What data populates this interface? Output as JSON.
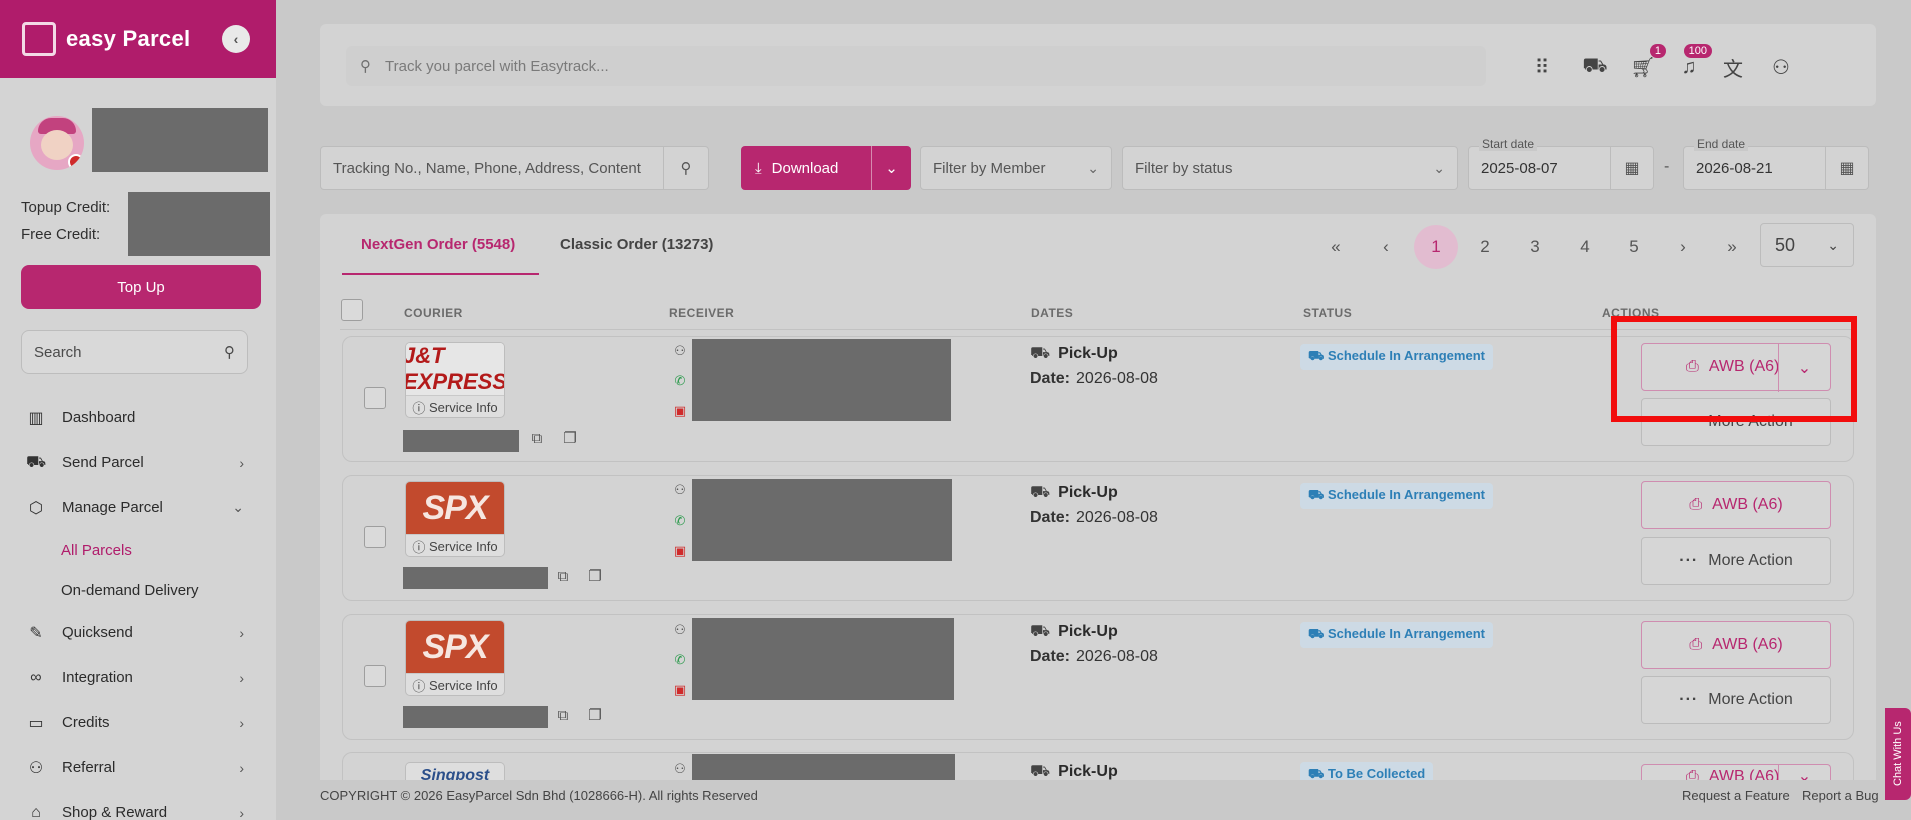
{
  "brand": {
    "name": "easy Parcel"
  },
  "sidebar": {
    "topup_credit_label": "Topup Credit:",
    "free_credit_label": "Free Credit:",
    "topup_button": "Top Up",
    "search_placeholder": "Search",
    "items": [
      {
        "label": "Dashboard",
        "icon": "chart-bar-icon"
      },
      {
        "label": "Send Parcel",
        "icon": "truck-icon"
      },
      {
        "label": "Manage Parcel",
        "icon": "box-icon"
      },
      {
        "label": "Quicksend",
        "icon": "pen-icon"
      },
      {
        "label": "Integration",
        "icon": "link-icon"
      },
      {
        "label": "Credits",
        "icon": "wallet-icon"
      },
      {
        "label": "Referral",
        "icon": "user-plus-icon"
      },
      {
        "label": "Shop & Reward",
        "icon": "shop-icon"
      }
    ],
    "sub_items": [
      "All Parcels",
      "On-demand Delivery"
    ]
  },
  "topbar": {
    "search_placeholder": "Track you parcel with Easytrack...",
    "cart_badge": "1",
    "notif_badge": "100"
  },
  "filters": {
    "search_placeholder": "Tracking No., Name, Phone, Address, Content",
    "download_label": "Download",
    "member_label": "Filter by Member",
    "status_label": "Filter by status",
    "start_label": "Start date",
    "start_value": "2025-08-07",
    "end_label": "End date",
    "end_value": "2026-08-21",
    "dash": "-"
  },
  "tabs": [
    {
      "label": "NextGen Order (5548)"
    },
    {
      "label": "Classic Order (13273)"
    }
  ],
  "pagination": {
    "pages": [
      "1",
      "2",
      "3",
      "4",
      "5"
    ],
    "first": "«",
    "prev": "‹",
    "next": "›",
    "last": "»",
    "page_size": "50"
  },
  "table": {
    "headers": [
      "COURIER",
      "RECEIVER",
      "DATES",
      "STATUS",
      "ACTIONS"
    ],
    "rows": [
      {
        "courier": "J&T EXPRESS",
        "service": "Service Info",
        "pickup": "Pick-Up",
        "date_label": "Date:",
        "date": "2026-08-08",
        "status": "Schedule In Arrangement",
        "awb": "AWB (A6)",
        "more": "More Action"
      },
      {
        "courier": "SPX",
        "service": "Service Info",
        "pickup": "Pick-Up",
        "date_label": "Date:",
        "date": "2026-08-08",
        "status": "Schedule In Arrangement",
        "awb": "AWB (A6)",
        "more": "More Action"
      },
      {
        "courier": "SPX",
        "service": "Service Info",
        "pickup": "Pick-Up",
        "date_label": "Date:",
        "date": "2026-08-08",
        "status": "Schedule In Arrangement",
        "awb": "AWB (A6)",
        "more": "More Action"
      },
      {
        "courier": "Singpost",
        "service": "",
        "pickup": "Pick-Up",
        "date_label": "",
        "date": "",
        "status": "To Be Collected",
        "awb": "AWB (A6)",
        "more": ""
      }
    ]
  },
  "footer": {
    "copyright": "COPYRIGHT © 2026 EasyParcel Sdn Bhd (1028666-H). All rights Reserved",
    "request": "Request a Feature",
    "bug": "Report a Bug"
  },
  "chat": "Chat With Us",
  "colors": {
    "brand": "#b01c6b",
    "highlight": "#f20d0d"
  }
}
